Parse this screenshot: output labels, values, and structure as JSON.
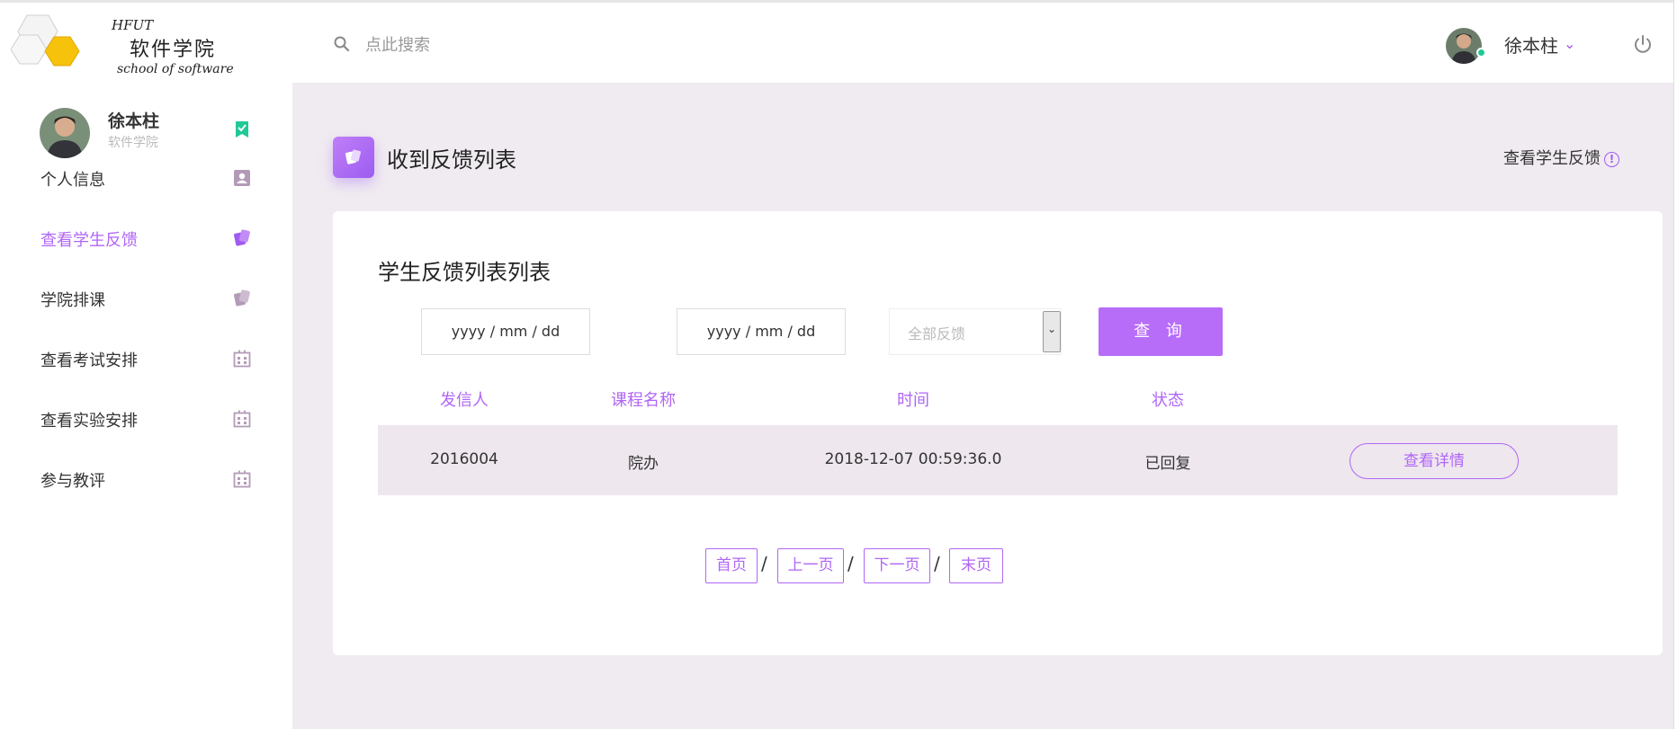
{
  "logo": {
    "hfut": "HFUT",
    "cn": "软件学院",
    "en": "school of software"
  },
  "search": {
    "placeholder": "点此搜索"
  },
  "header": {
    "username": "徐本柱",
    "dropdown_icon": "chevron-down-icon",
    "power_icon": "power-icon"
  },
  "sidebar": {
    "profile": {
      "name": "徐本柱",
      "dept": "软件学院"
    },
    "items": [
      {
        "label": "个人信息",
        "icon": "contact-card-icon"
      },
      {
        "label": "查看学生反馈",
        "icon": "cards-icon",
        "active": true
      },
      {
        "label": "学院排课",
        "icon": "cards-icon"
      },
      {
        "label": "查看考试安排",
        "icon": "building-icon"
      },
      {
        "label": "查看实验安排",
        "icon": "building-icon"
      },
      {
        "label": "参与教评",
        "icon": "building-icon"
      }
    ]
  },
  "main": {
    "page_title": "收到反馈列表",
    "breadcrumb": "查看学生反馈",
    "card": {
      "title": "学生反馈列表列表",
      "filters": {
        "start_date_placeholder": "yyyy / mm / dd",
        "end_date_placeholder": "yyyy / mm / dd",
        "type_selected": "全部反馈",
        "query_label": "查 询"
      },
      "table": {
        "headers": [
          "发信人",
          "课程名称",
          "时间",
          "状态"
        ],
        "rows": [
          {
            "sender": "2016004",
            "course": "院办",
            "time": "2018-12-07 00:59:36.0",
            "status": "已回复",
            "action": "查看详情"
          }
        ]
      },
      "pager": {
        "first": "首页",
        "prev": "上一页",
        "next": "下一页",
        "last": "末页",
        "separator": "/"
      }
    }
  },
  "colors": {
    "accent": "#b066f5",
    "main_bg": "#f0ebf1",
    "row_bg": "#eee7ee",
    "online": "#20c997"
  }
}
